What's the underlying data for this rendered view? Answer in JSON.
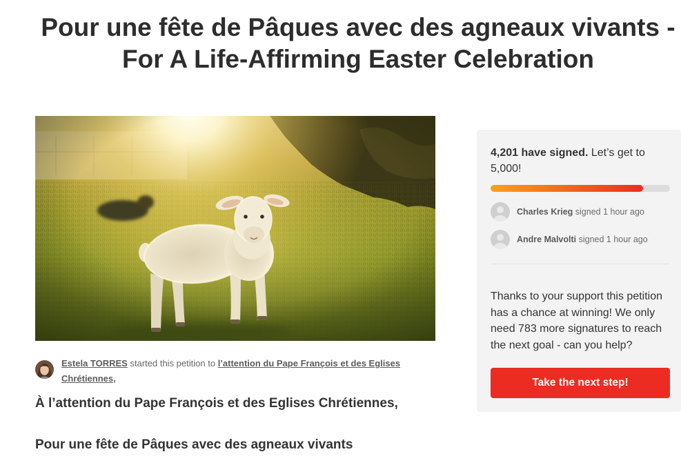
{
  "page": {
    "title_line1": "Pour une fête de Pâques avec des agneaux vivants -",
    "title_line2": "For A Life-Affirming Easter Celebration"
  },
  "author": {
    "name": "Estela TORRES",
    "action": "started this petition to",
    "recipient": "l’attention du Pape François et des Eglises Chrétiennes,"
  },
  "body": {
    "greeting": "À l’attention du Pape François et des Eglises Chrétiennes,",
    "heading": "Pour une fête de Pâques avec des agneaux vivants"
  },
  "sidebar": {
    "signed_count_text": "4,201 have signed.",
    "goal_text": "Let’s get to 5,000!",
    "progress": 0.85,
    "recent_signers": [
      {
        "name": "Charles Krieg",
        "action": "signed 1 hour ago"
      },
      {
        "name": "Andre Malvolti",
        "action": "signed 1 hour ago"
      }
    ],
    "support_message": "Thanks to your support this petition has a chance at winning! We only need 783 more signatures to reach the next goal - can you help?",
    "cta_label": "Take the next step!"
  },
  "icons": {
    "signer_avatar": "user-avatar-icon"
  },
  "colors": {
    "accent": "#ec2c22",
    "progress_start": "#f7a21b",
    "progress_end": "#ec2c22",
    "sidebar_bg": "#f3f3f3"
  }
}
